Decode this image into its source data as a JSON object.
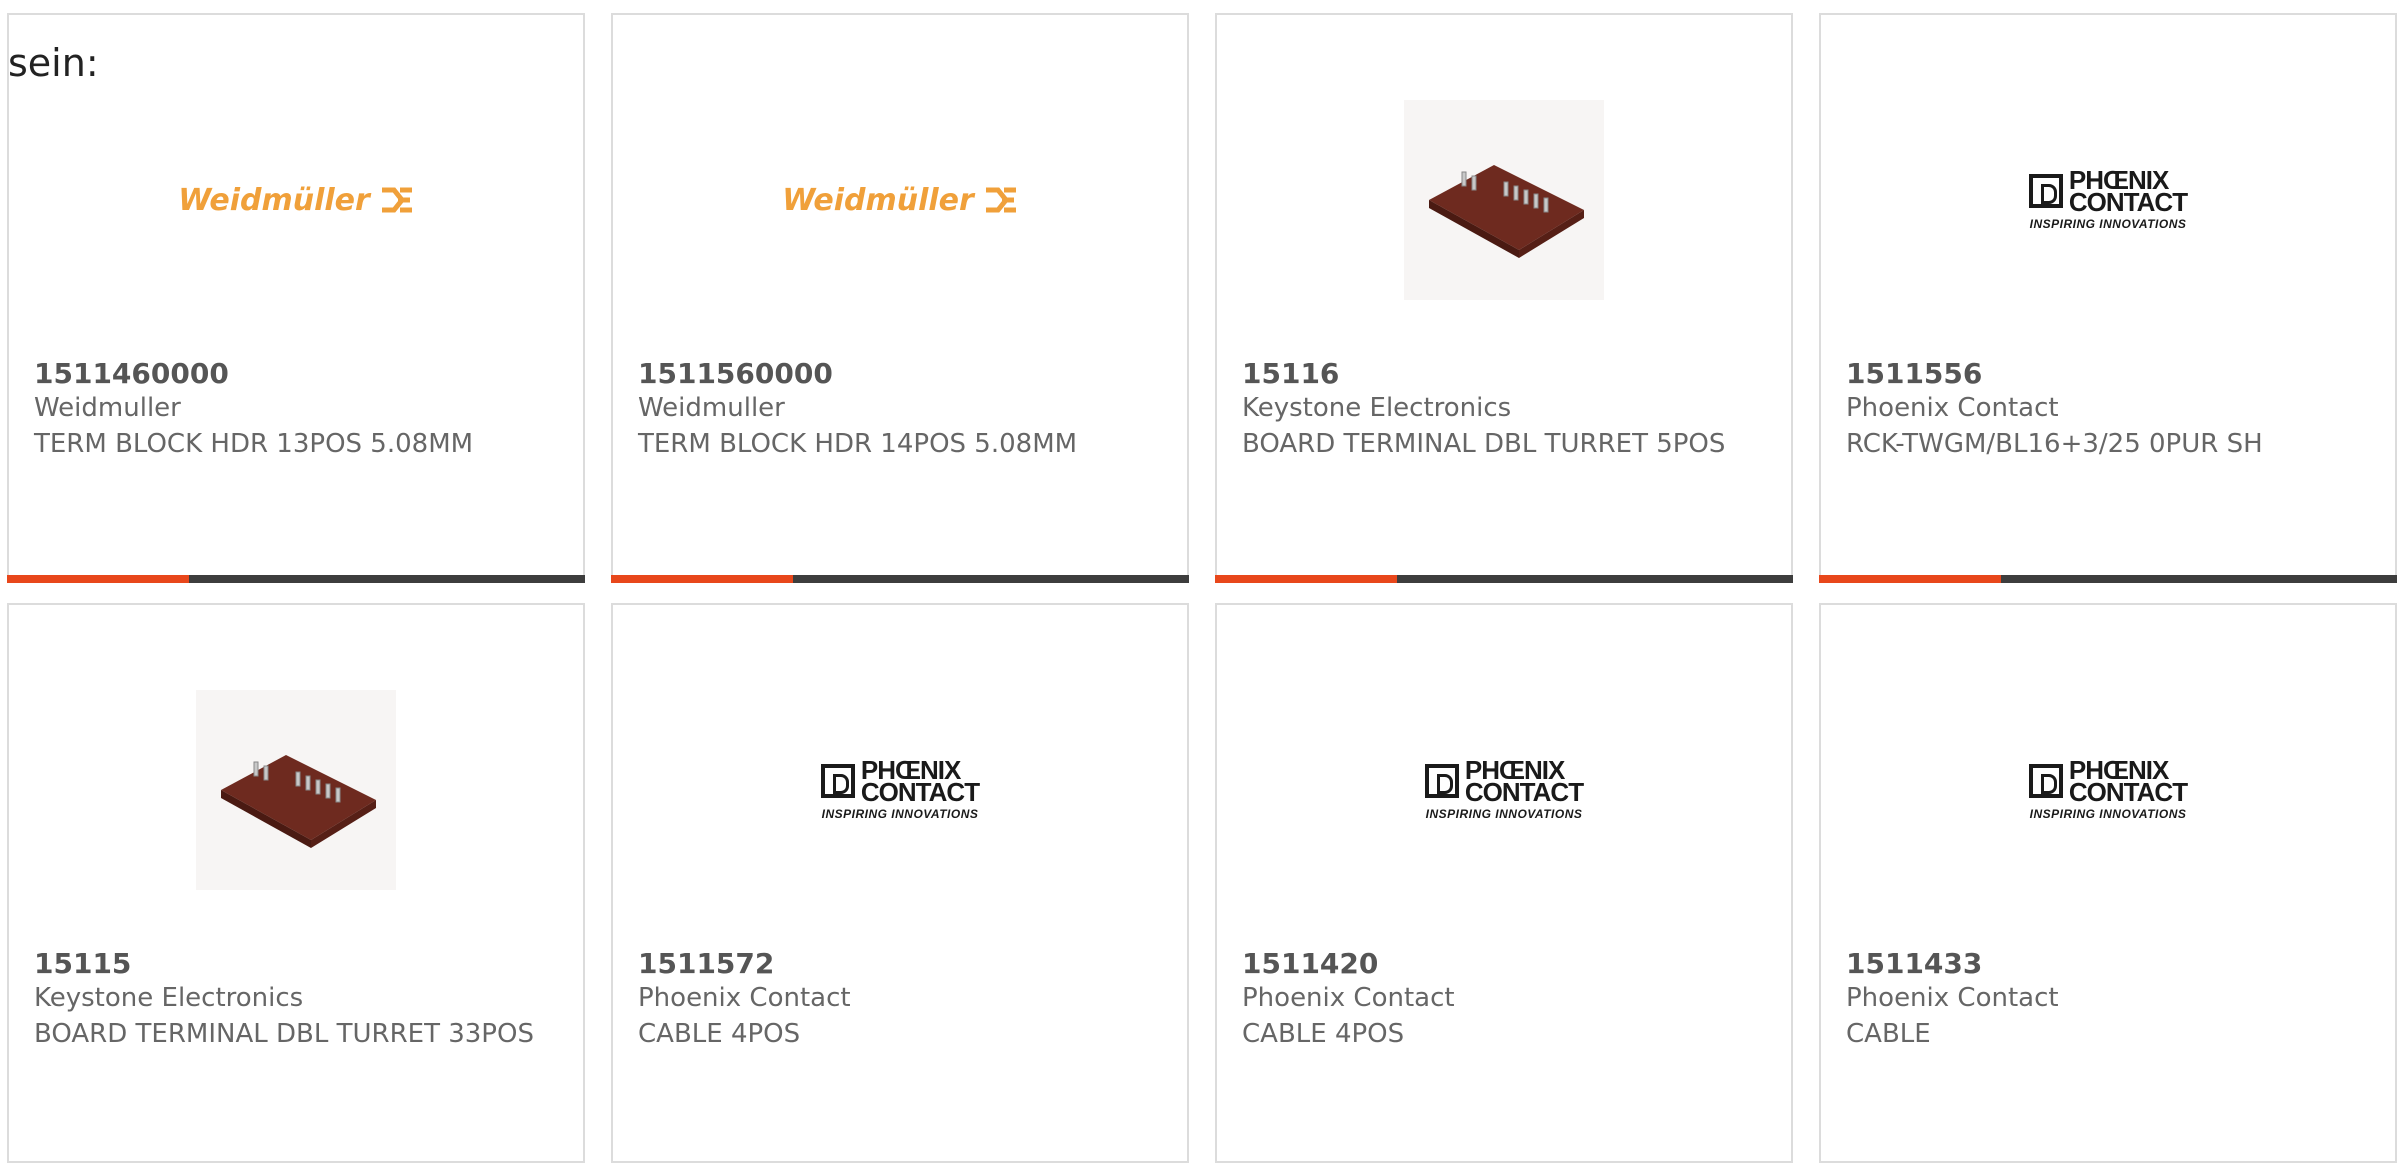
{
  "intro_text": "sein:",
  "accent_color": "#e8471b",
  "bar_color": "#3d3d3d",
  "products": [
    {
      "part_number": "1511460000",
      "manufacturer": "Weidmuller",
      "description": "TERM BLOCK HDR 13POS 5.08MM",
      "image": "weidmuller-logo",
      "logo_text": "Weidmüller"
    },
    {
      "part_number": "1511560000",
      "manufacturer": "Weidmuller",
      "description": "TERM BLOCK HDR 14POS 5.08MM",
      "image": "weidmuller-logo",
      "logo_text": "Weidmüller"
    },
    {
      "part_number": "15116",
      "manufacturer": "Keystone Electronics",
      "description": "BOARD TERMINAL DBL TURRET 5POS",
      "image": "board-terminal-photo"
    },
    {
      "part_number": "1511556",
      "manufacturer": "Phoenix Contact",
      "description": "RCK-TWGM/BL16+3/25 0PUR SH",
      "image": "phoenix-contact-logo",
      "logo_line1": "PHŒNIX",
      "logo_line2": "CONTACT",
      "logo_tag": "INSPIRING INNOVATIONS"
    },
    {
      "part_number": "15115",
      "manufacturer": "Keystone Electronics",
      "description": "BOARD TERMINAL DBL TURRET 33POS",
      "image": "board-terminal-photo"
    },
    {
      "part_number": "1511572",
      "manufacturer": "Phoenix Contact",
      "description": "CABLE 4POS",
      "image": "phoenix-contact-logo",
      "logo_line1": "PHŒNIX",
      "logo_line2": "CONTACT",
      "logo_tag": "INSPIRING INNOVATIONS"
    },
    {
      "part_number": "1511420",
      "manufacturer": "Phoenix Contact",
      "description": "CABLE 4POS",
      "image": "phoenix-contact-logo",
      "logo_line1": "PHŒNIX",
      "logo_line2": "CONTACT",
      "logo_tag": "INSPIRING INNOVATIONS"
    },
    {
      "part_number": "1511433",
      "manufacturer": "Phoenix Contact",
      "description": "CABLE",
      "image": "phoenix-contact-logo",
      "logo_line1": "PHŒNIX",
      "logo_line2": "CONTACT",
      "logo_tag": "INSPIRING INNOVATIONS"
    }
  ]
}
